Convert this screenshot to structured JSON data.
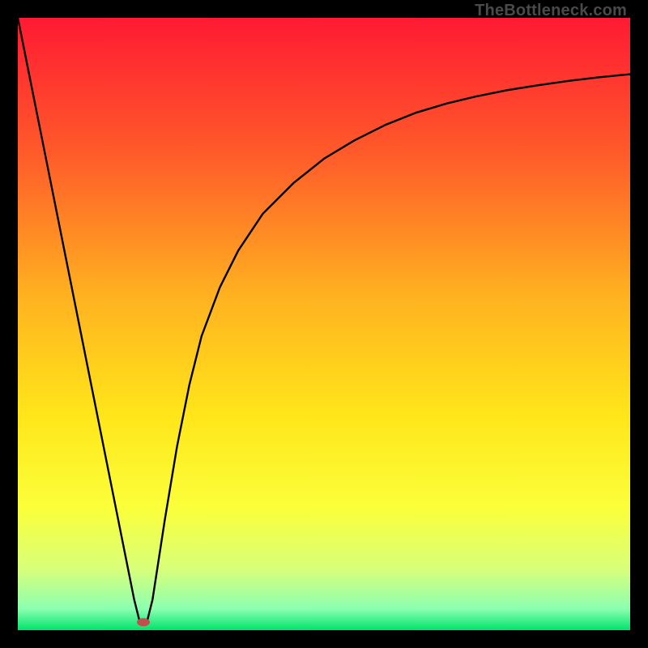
{
  "watermark": "TheBottleneck.com",
  "chart_data": {
    "type": "line",
    "title": "",
    "xlabel": "",
    "ylabel": "",
    "xlim": [
      0,
      100
    ],
    "ylim": [
      0,
      100
    ],
    "grid": false,
    "legend": false,
    "background_gradient": {
      "stops": [
        {
          "offset": 0.0,
          "color": "#ff1a33"
        },
        {
          "offset": 0.22,
          "color": "#ff5a2a"
        },
        {
          "offset": 0.45,
          "color": "#ffb020"
        },
        {
          "offset": 0.65,
          "color": "#ffe61a"
        },
        {
          "offset": 0.8,
          "color": "#fbff3a"
        },
        {
          "offset": 0.9,
          "color": "#d8ff7a"
        },
        {
          "offset": 0.965,
          "color": "#8cffb0"
        },
        {
          "offset": 1.0,
          "color": "#00e36b"
        }
      ]
    },
    "marker": {
      "x": 20.5,
      "y": 1.3,
      "color": "#c0504d",
      "rx": 8,
      "ry": 5
    },
    "series": [
      {
        "name": "curve",
        "x": [
          0,
          2,
          4,
          6,
          8,
          10,
          12,
          14,
          16,
          18,
          19,
          20,
          21,
          22,
          24,
          26,
          28,
          30,
          33,
          36,
          40,
          45,
          50,
          55,
          60,
          65,
          70,
          75,
          80,
          85,
          90,
          95,
          100
        ],
        "y": [
          100,
          90,
          80,
          70,
          60,
          50,
          40,
          30,
          20,
          10,
          5,
          1,
          1,
          5,
          18,
          30,
          40,
          48,
          56,
          62,
          68,
          73,
          77,
          80,
          82.5,
          84.5,
          86,
          87.2,
          88.2,
          89,
          89.7,
          90.3,
          90.8
        ]
      }
    ]
  }
}
